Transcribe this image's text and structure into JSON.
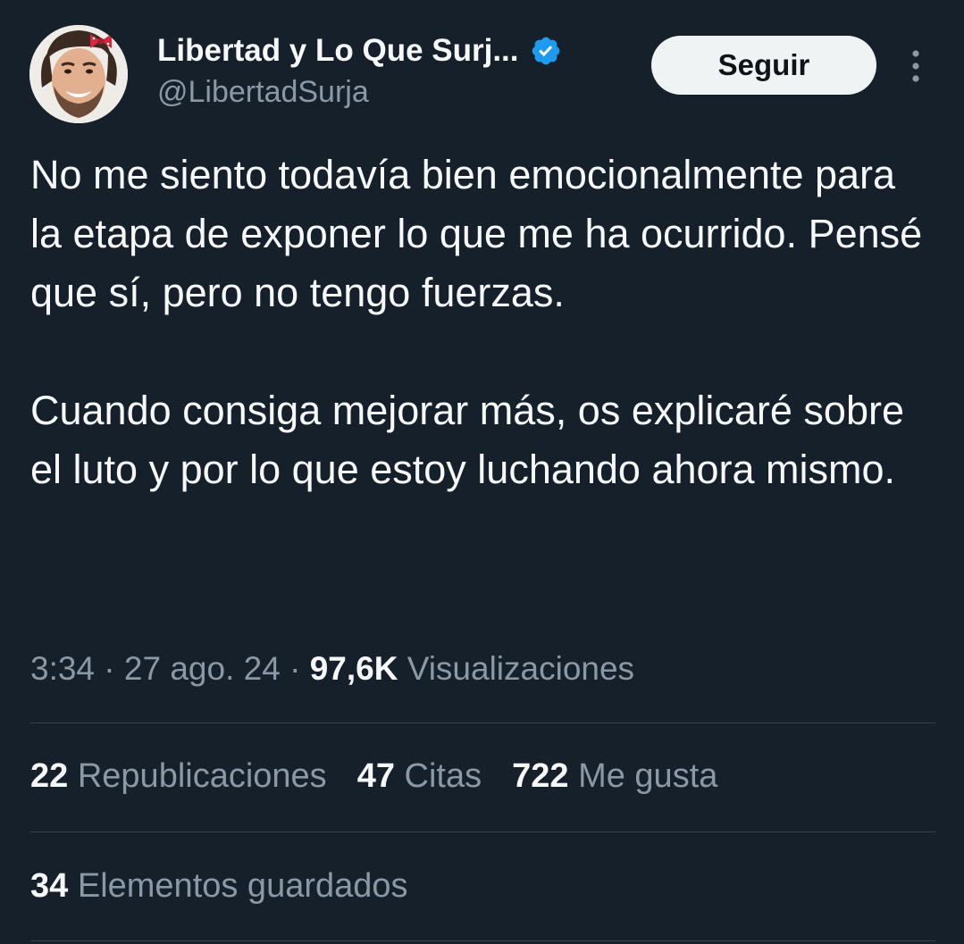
{
  "header": {
    "display_name": "Libertad y Lo Que Surj...",
    "handle": "@LibertadSurja",
    "follow_label": "Seguir",
    "verified_icon": "verified-badge-icon",
    "avatar": "avatar"
  },
  "tweet": {
    "paragraph_1": "No me siento todavía bien emocionalmente para la etapa de exponer lo que me ha ocurrido. Pensé que sí, pero no tengo fuerzas.",
    "paragraph_2": "Cuando consiga mejorar más, os explicaré sobre el luto y por lo que estoy luchando ahora mismo."
  },
  "meta": {
    "time": "3:34",
    "separator": "·",
    "date": "27 ago. 24",
    "views_count": "97,6K",
    "views_label": "Visualizaciones"
  },
  "stats": {
    "reposts_count": "22",
    "reposts_label": "Republicaciones",
    "quotes_count": "47",
    "quotes_label": "Citas",
    "likes_count": "722",
    "likes_label": "Me gusta",
    "bookmarks_count": "34",
    "bookmarks_label": "Elementos guardados"
  },
  "colors": {
    "background": "#15202b",
    "text_primary": "#f7f9f9",
    "text_secondary": "#8b98a5",
    "verified_blue": "#1d9bf0",
    "divider": "#38444d",
    "button_bg": "#eff3f4"
  }
}
